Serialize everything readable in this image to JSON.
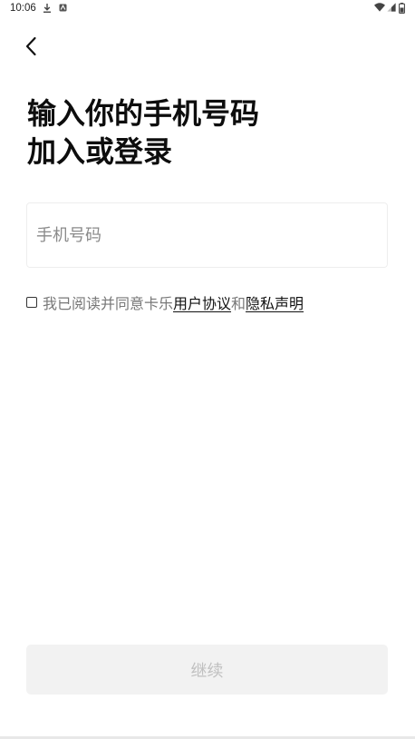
{
  "status_bar": {
    "time": "10:06",
    "left_icons": [
      "download-icon",
      "notification-app-icon"
    ],
    "right_icons": [
      "wifi-icon",
      "cellular-signal-icon",
      "battery-icon"
    ]
  },
  "header": {
    "back_icon": "chevron-left-icon"
  },
  "title": {
    "line1": "输入你的手机号码",
    "line2": "加入或登录"
  },
  "phone_field": {
    "placeholder": "手机号码",
    "value": ""
  },
  "agreement": {
    "checked": false,
    "prefix": "我已阅读并同意卡乐",
    "terms_link": "用户协议",
    "conjunction": "和",
    "privacy_link": "隐私声明"
  },
  "actions": {
    "continue_label": "继续"
  },
  "colors": {
    "text_primary": "#0d0d0d",
    "text_secondary": "#777777",
    "button_disabled_bg": "#f2f2f2",
    "button_disabled_text": "#c0c0c0",
    "field_border": "#eeeeee"
  }
}
